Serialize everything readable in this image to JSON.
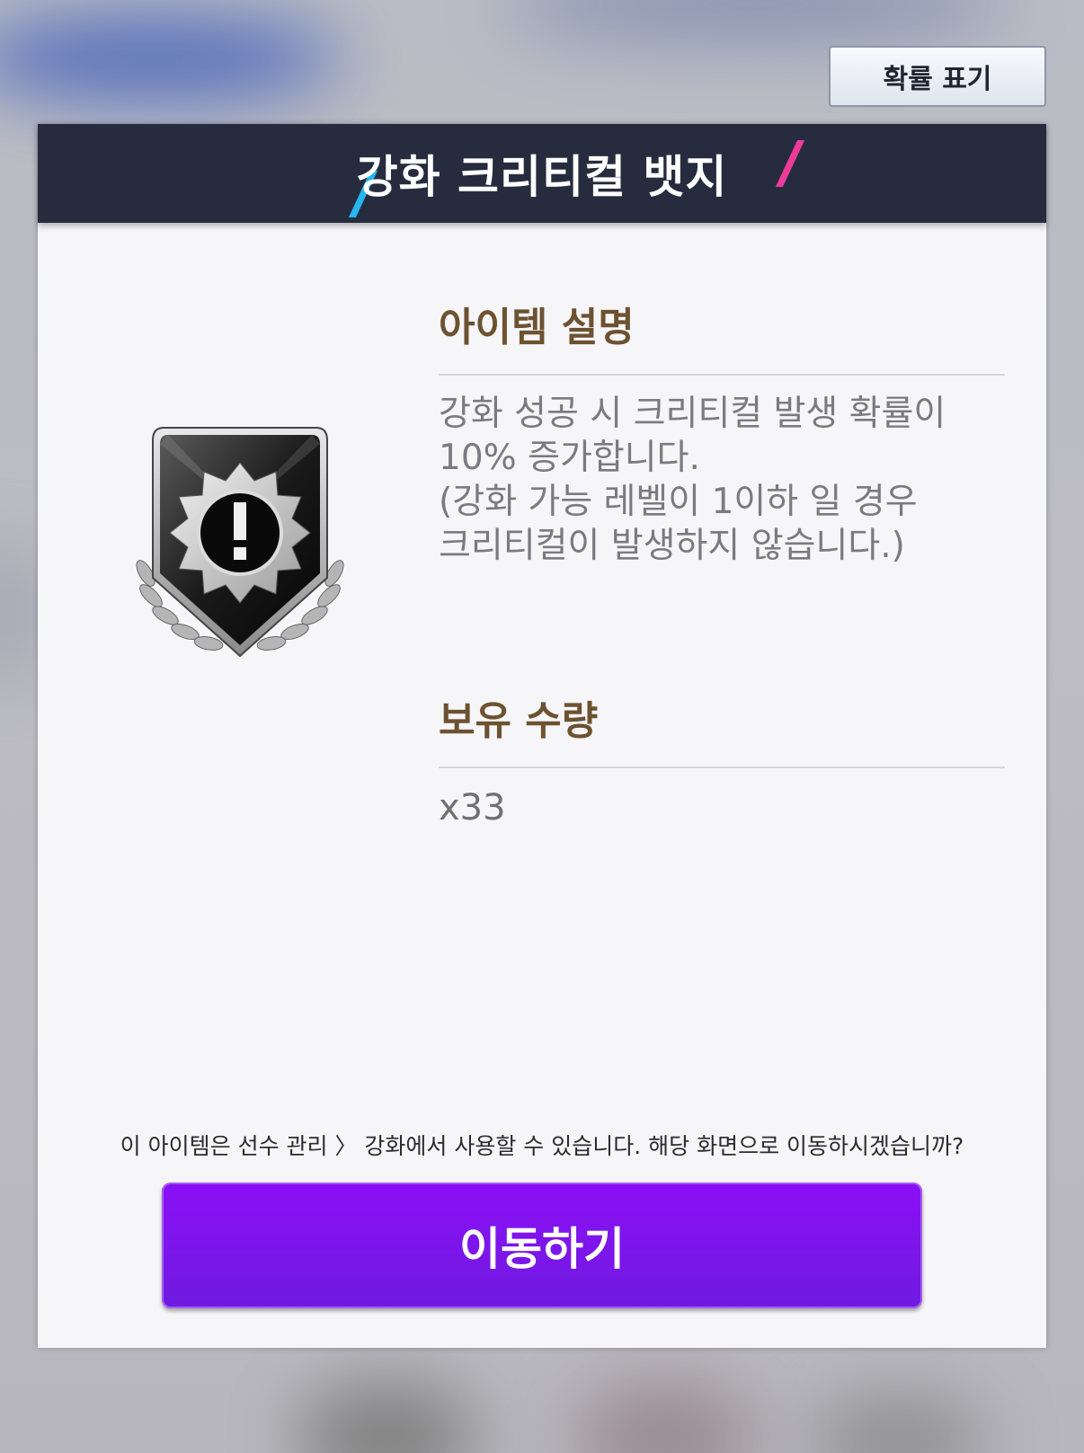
{
  "top_bar": {
    "probability_button_label": "확률 표기"
  },
  "dialog": {
    "title": "강화 크리티컬 뱃지",
    "description": {
      "heading": "아이템 설명",
      "body": "강화 성공 시 크리티컬 발생 확률이\n10% 증가합니다.\n(강화 가능 레벨이 1이하 일 경우\n크리티컬이 발생하지 않습니다.)"
    },
    "quantity": {
      "heading": "보유 수량",
      "value": "x33"
    },
    "notice": "이 아이템은 선수 관리 〉 강화에서 사용할 수 있습니다. 해당 화면으로 이동하시겠습니까?",
    "go_button_label": "이동하기",
    "item_icon": "critical-badge-icon"
  },
  "colors": {
    "header_bg": "#262c3d",
    "section_heading": "#6d5231",
    "go_button": "#7f14ec",
    "accent_blue": "#25b6f0",
    "accent_pink": "#ef3a9c"
  }
}
